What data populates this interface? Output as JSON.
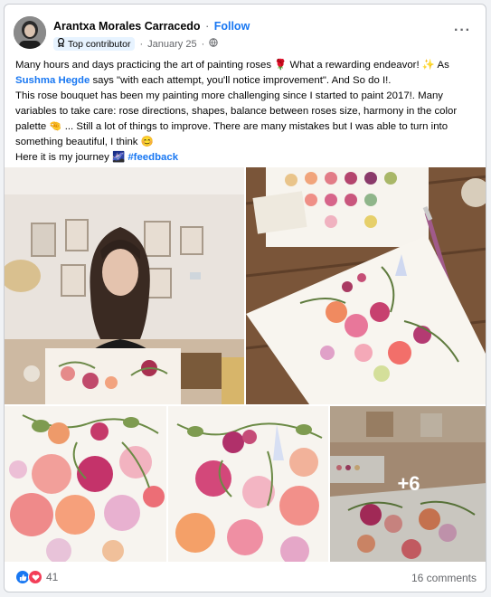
{
  "post": {
    "author": "Arantxa Morales Carracedo",
    "separator": "·",
    "follow_label": "Follow",
    "badge_label": "Top contributor",
    "date": "January 25",
    "more_label": "···"
  },
  "text": {
    "line1_a": "Many hours and days practicing the art of painting roses 🌹 What a rewarding endeavor! ✨ As",
    "mention": "Sushma Hegde",
    "line2_b": " says \"with each attempt, you'll notice improvement\". And So do I!.",
    "line3": "This rose bouquet has been my painting more challenging since I started to paint 2017!. Many variables to take care: rose directions, shapes, balance between roses size, harmony in the color palette 🤏 ... Still a lot of things to improve. There are many mistakes but I was able to turn into something beautiful, I think 😊",
    "line4_a": "Here it is my journey 🌌 ",
    "hashtag": "#feedback"
  },
  "photos": {
    "more_count": "+6"
  },
  "footer": {
    "reaction_count": "41",
    "comments": "16 comments"
  },
  "colors": {
    "link": "#1877f2",
    "like": "#1877f2",
    "love": "#f33e58"
  }
}
